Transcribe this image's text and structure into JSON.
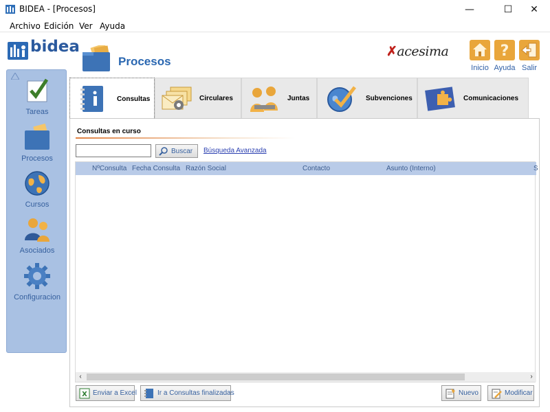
{
  "window": {
    "title": "BIDEA - [Procesos]",
    "minimize_glyph": "—",
    "maximize_glyph": "☐",
    "close_glyph": "✕"
  },
  "menu": [
    "Archivo",
    "Edición",
    "Ver",
    "Ayuda"
  ],
  "logo_text": "bidea",
  "page_title": "Procesos",
  "partner_logo": {
    "prefix": "✗",
    "text": "acesima"
  },
  "top_buttons": [
    {
      "label": "Inicio",
      "icon": "home-icon"
    },
    {
      "label": "Ayuda",
      "icon": "help-icon"
    },
    {
      "label": "Salir",
      "icon": "exit-icon"
    }
  ],
  "sidebar": {
    "items": [
      {
        "label": "Tareas",
        "icon": "tasks-checkmark-icon"
      },
      {
        "label": "Procesos",
        "icon": "folder-icon"
      },
      {
        "label": "Cursos",
        "icon": "globe-icon"
      },
      {
        "label": "Asociados",
        "icon": "people-icon"
      },
      {
        "label": "Configuracion",
        "icon": "gear-icon"
      }
    ]
  },
  "tabs": [
    {
      "label": "Consultas",
      "icon": "notebook-info-icon",
      "active": true
    },
    {
      "label": "Circulares",
      "icon": "envelopes-gear-icon",
      "active": false
    },
    {
      "label": "Juntas",
      "icon": "meeting-people-icon",
      "active": false
    },
    {
      "label": "Subvenciones",
      "icon": "globe-check-icon",
      "active": false
    },
    {
      "label": "Comunicaciones",
      "icon": "puzzle-board-icon",
      "active": false
    }
  ],
  "section_label": "Consultas en curso",
  "search": {
    "value": "",
    "button_label": "Buscar",
    "advanced_link": "Búsqueda Avanzada"
  },
  "grid": {
    "columns": [
      "NºConsulta",
      "Fecha Consulta",
      "Razón Social",
      "Contacto",
      "Asunto (Interno)",
      "S"
    ],
    "rows": []
  },
  "bottom_buttons": {
    "export": "Enviar a Excel",
    "finished": "Ir a Consultas finalizadas",
    "new": "Nuevo",
    "modify": "Modificar"
  },
  "colors": {
    "accent": "#2a67b1",
    "sidebar_bg": "#a9c1e3",
    "grid_header": "#b9cbe8",
    "link": "#2a3fb0"
  }
}
